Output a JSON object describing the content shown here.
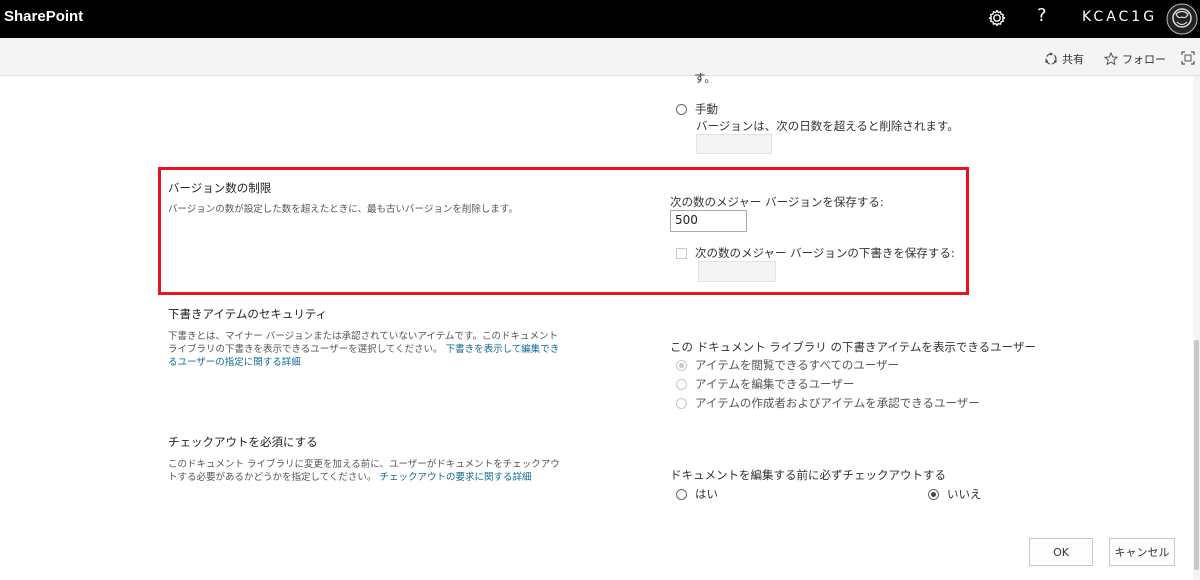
{
  "suitebar": {
    "brand": "SharePoint",
    "help_label": "?",
    "user_name": "KCAC1G"
  },
  "command_bar": {
    "share_label": "共有",
    "follow_label": "フォロー"
  },
  "expiration": {
    "cut_text": "す。",
    "manual_label": "手動",
    "manual_desc": "バージョンは、次の日数を超えると削除されます。",
    "days_value": ""
  },
  "version_limit": {
    "title": "バージョン数の制限",
    "description": "バージョンの数が設定した数を超えたときに、最も古いバージョンを削除します。",
    "major_label": "次の数のメジャー バージョンを保存する:",
    "major_value": "500",
    "drafts_label": "次の数のメジャー バージョンの下書きを保存する:",
    "drafts_value": ""
  },
  "draft_security": {
    "title": "下書きアイテムのセキュリティ",
    "description": "下書きとは、マイナー バージョンまたは承認されていないアイテムです。このドキュメント ライブラリの下書きを表示できるユーザーを選択してください。",
    "link": "下書きを表示して編集できるユーザーの指定に関する詳細",
    "question": "この ドキュメント ライブラリ の下書きアイテムを表示できるユーザー",
    "options": [
      "アイテムを閲覧できるすべてのユーザー",
      "アイテムを編集できるユーザー",
      "アイテムの作成者およびアイテムを承認できるユーザー"
    ]
  },
  "checkout": {
    "title": "チェックアウトを必須にする",
    "description": "このドキュメント ライブラリに変更を加える前に、ユーザーがドキュメントをチェックアウトする必要があるかどうかを指定してください。",
    "link": "チェックアウトの要求に関する詳細",
    "question": "ドキュメントを編集する前に必ずチェックアウトする",
    "yes_label": "はい",
    "no_label": "いいえ"
  },
  "footer": {
    "ok_label": "OK",
    "cancel_label": "キャンセル"
  },
  "colors": {
    "suitebar": "#000000",
    "highlight_border": "#e3161f",
    "link": "#0f6a94"
  }
}
